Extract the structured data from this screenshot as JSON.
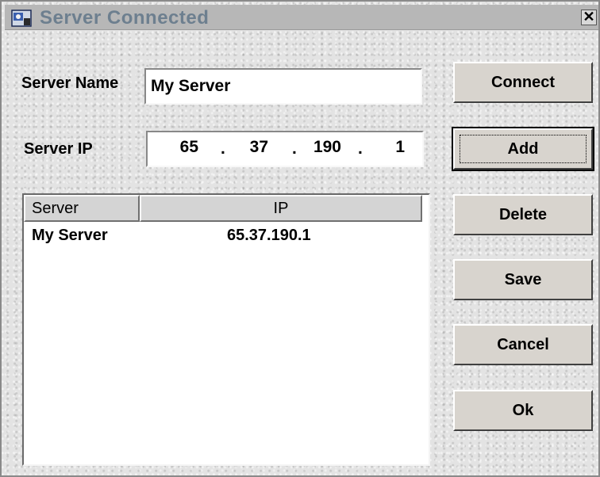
{
  "window": {
    "title": "Server Connected",
    "icon": "app-icon",
    "close_label": "✕"
  },
  "form": {
    "server_name_label": "Server Name",
    "server_name_value": "My Server",
    "server_ip_label": "Server IP",
    "ip_octets": [
      "65",
      "37",
      "190",
      "1"
    ],
    "ip_dot": "."
  },
  "list": {
    "columns": [
      "Server",
      "IP"
    ],
    "rows": [
      {
        "server": "My Server",
        "ip": "65.37.190.1"
      }
    ]
  },
  "buttons": {
    "connect": "Connect",
    "add": "Add",
    "delete": "Delete",
    "save": "Save",
    "cancel": "Cancel",
    "ok": "Ok"
  }
}
